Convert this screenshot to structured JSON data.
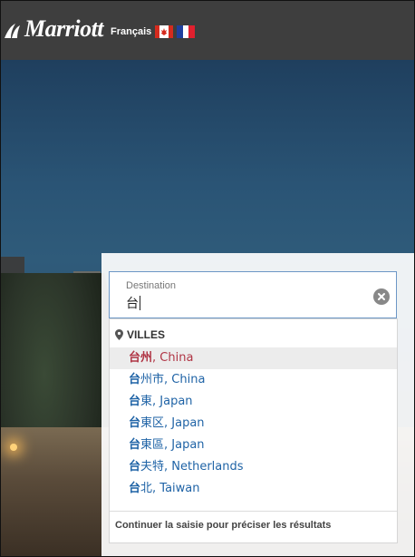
{
  "header": {
    "logo_text": "Marriott",
    "language_label": "Français",
    "flags": [
      "canada-flag-icon",
      "france-flag-icon"
    ],
    "background": "#3e3e3e"
  },
  "search": {
    "destination_label": "Destination",
    "destination_value": "台",
    "clear_icon": "clear-circle-icon"
  },
  "suggestions": {
    "section_title": "VILLES",
    "section_icon": "map-pin-icon",
    "items": [
      {
        "match": "台州",
        "rest": ", China"
      },
      {
        "match": "台",
        "rest": "州市, China"
      },
      {
        "match": "台",
        "rest": "東, Japan"
      },
      {
        "match": "台",
        "rest": "東区, Japan"
      },
      {
        "match": "台",
        "rest": "東區, Japan"
      },
      {
        "match": "台",
        "rest": "夫特, Netherlands"
      },
      {
        "match": "台",
        "rest": "北, Taiwan"
      }
    ],
    "footer_hint": "Continuer la saisie pour préciser les résultats"
  },
  "colors": {
    "link": "#1f63a6",
    "active_item": "#b03545",
    "field_border": "#6d97c6"
  }
}
